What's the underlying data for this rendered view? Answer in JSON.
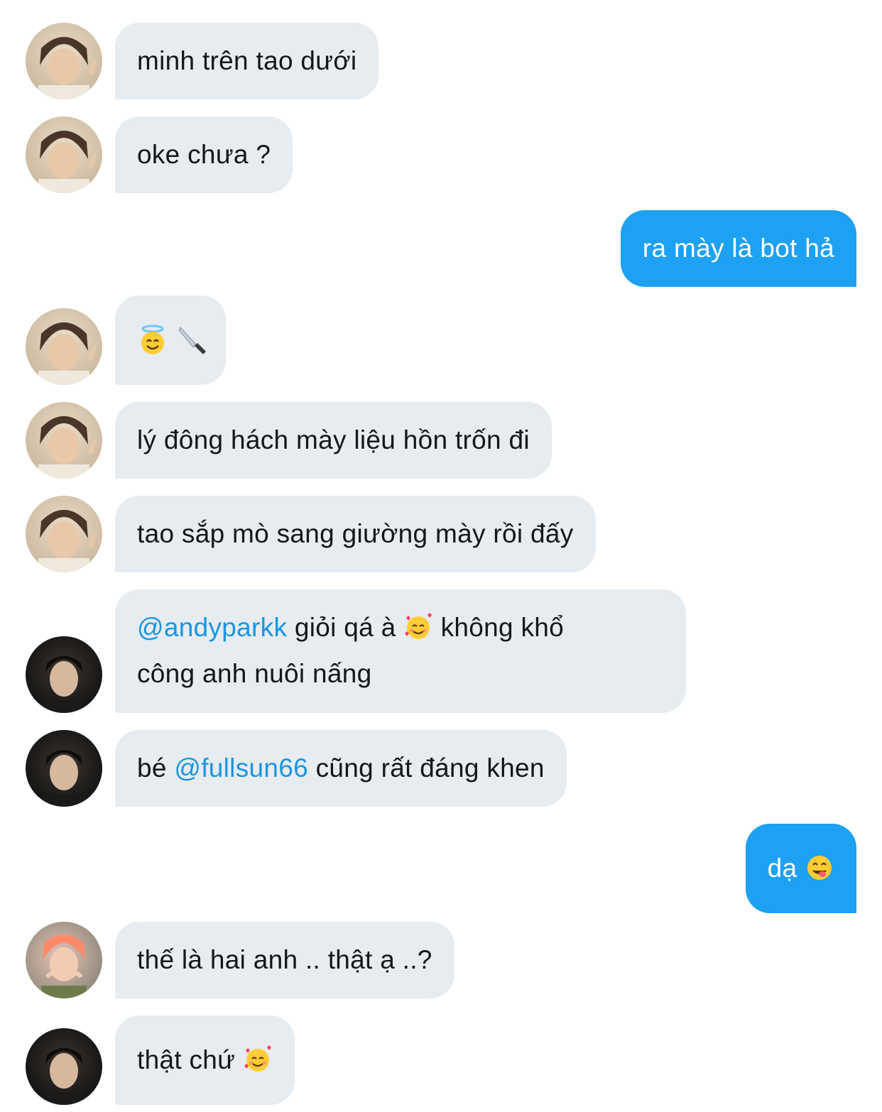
{
  "messages": [
    {
      "id": "m1",
      "side": "in",
      "avatar": "avatar-a",
      "text": "minh trên tao dưới"
    },
    {
      "id": "m2",
      "side": "in",
      "avatar": "avatar-a",
      "text": "oke chưa ?"
    },
    {
      "id": "m3",
      "side": "out",
      "text": "ra mày là bot hả"
    },
    {
      "id": "m4",
      "side": "in",
      "avatar": "avatar-a",
      "emoji": [
        "halo-smile-emoji",
        "knife-emoji"
      ]
    },
    {
      "id": "m5",
      "side": "in",
      "avatar": "avatar-a",
      "text": "lý đông hách mày liệu hồn trốn đi"
    },
    {
      "id": "m6",
      "side": "in",
      "avatar": "avatar-a",
      "text": "tao sắp mò sang giường mày rồi đấy"
    },
    {
      "id": "m7",
      "side": "in",
      "avatar": "avatar-b",
      "mention": "@andyparkk",
      "text_a": " giỏi qá à ",
      "emoji": "smiling-hearts-emoji",
      "text_b": " không khổ",
      "line2": "công anh nuôi nấng"
    },
    {
      "id": "m8",
      "side": "in",
      "avatar": "avatar-b",
      "text_a": "bé ",
      "mention": "@fullsun66",
      "text_b": " cũng rất đáng khen"
    },
    {
      "id": "m9",
      "side": "out",
      "text": "dạ ",
      "emoji": "yum-emoji"
    },
    {
      "id": "m10",
      "side": "in",
      "avatar": "avatar-c",
      "text": "thế là hai anh .. thật ạ ..?"
    },
    {
      "id": "m11",
      "side": "in",
      "avatar": "avatar-b",
      "text": "thật chứ ",
      "emoji": "smiling-hearts-emoji"
    }
  ],
  "colors": {
    "incoming_bubble": "#e6ecf0",
    "outgoing_bubble": "#1da1f2",
    "mention": "#1b95e0",
    "text": "#14171a"
  }
}
